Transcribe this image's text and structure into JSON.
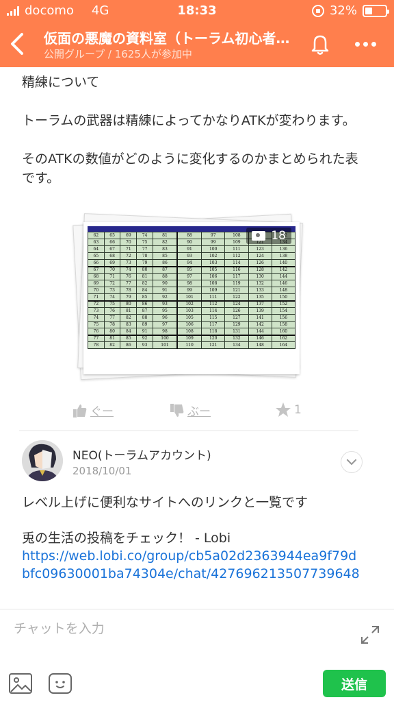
{
  "status_bar": {
    "carrier": "docomo",
    "network": "4G",
    "time": "18:33",
    "battery": "32%"
  },
  "header": {
    "title": "仮面の悪魔の資料室（トーラム初心者向け）",
    "subtitle": "公開グループ / 1625人が参加中",
    "bg_color": "#ff7f4d"
  },
  "post1": {
    "lines": [
      "精練について",
      "トーラムの武器は精練によってかなりATKが変わります。",
      "そのATKの数値がどのように変化するのかまとめられた表です。"
    ],
    "photo_count": "18",
    "table_rows": [
      [
        "62",
        "65",
        "69",
        "74",
        "81",
        "88",
        "97",
        "108",
        "119",
        "132"
      ],
      [
        "63",
        "66",
        "70",
        "75",
        "82",
        "90",
        "99",
        "109",
        "121",
        "134"
      ],
      [
        "64",
        "67",
        "71",
        "77",
        "83",
        "91",
        "100",
        "111",
        "123",
        "136"
      ],
      [
        "65",
        "68",
        "72",
        "78",
        "85",
        "93",
        "102",
        "112",
        "124",
        "138"
      ],
      [
        "66",
        "69",
        "73",
        "79",
        "86",
        "94",
        "103",
        "114",
        "126",
        "140"
      ],
      [
        "67",
        "70",
        "74",
        "80",
        "87",
        "95",
        "105",
        "116",
        "128",
        "142"
      ],
      [
        "68",
        "71",
        "76",
        "81",
        "88",
        "97",
        "106",
        "117",
        "130",
        "144"
      ],
      [
        "69",
        "72",
        "77",
        "82",
        "90",
        "98",
        "108",
        "119",
        "132",
        "146"
      ],
      [
        "70",
        "73",
        "78",
        "84",
        "91",
        "99",
        "109",
        "121",
        "133",
        "148"
      ],
      [
        "71",
        "74",
        "79",
        "85",
        "92",
        "101",
        "111",
        "122",
        "135",
        "150"
      ],
      [
        "72",
        "75",
        "80",
        "86",
        "93",
        "102",
        "112",
        "124",
        "137",
        "152"
      ],
      [
        "73",
        "76",
        "81",
        "87",
        "95",
        "103",
        "114",
        "126",
        "139",
        "154"
      ],
      [
        "74",
        "77",
        "82",
        "88",
        "96",
        "105",
        "115",
        "127",
        "141",
        "156"
      ],
      [
        "75",
        "78",
        "83",
        "89",
        "97",
        "106",
        "117",
        "129",
        "142",
        "158"
      ],
      [
        "76",
        "80",
        "84",
        "91",
        "98",
        "108",
        "118",
        "131",
        "144",
        "160"
      ],
      [
        "77",
        "81",
        "85",
        "92",
        "100",
        "109",
        "120",
        "132",
        "146",
        "162"
      ],
      [
        "78",
        "82",
        "86",
        "93",
        "101",
        "110",
        "121",
        "134",
        "148",
        "164"
      ]
    ],
    "reactions": {
      "good": "ぐー",
      "boo": "ぶー",
      "star_count": "1"
    }
  },
  "post2": {
    "username": "NEO(トーラムアカウント)",
    "date": "2018/10/01",
    "text1": "レベル上げに便利なサイトへのリンクと一覧です",
    "text2": "兎の生活の投稿をチェック！ - Lobi",
    "link": "https://web.lobi.co/group/cb5a02d2363944ea9f79dbfc09630001ba74304e/chat/427696213507739648"
  },
  "input_bar": {
    "placeholder": "チャットを入力",
    "send_label": "送信",
    "send_color": "#1fc24c"
  }
}
